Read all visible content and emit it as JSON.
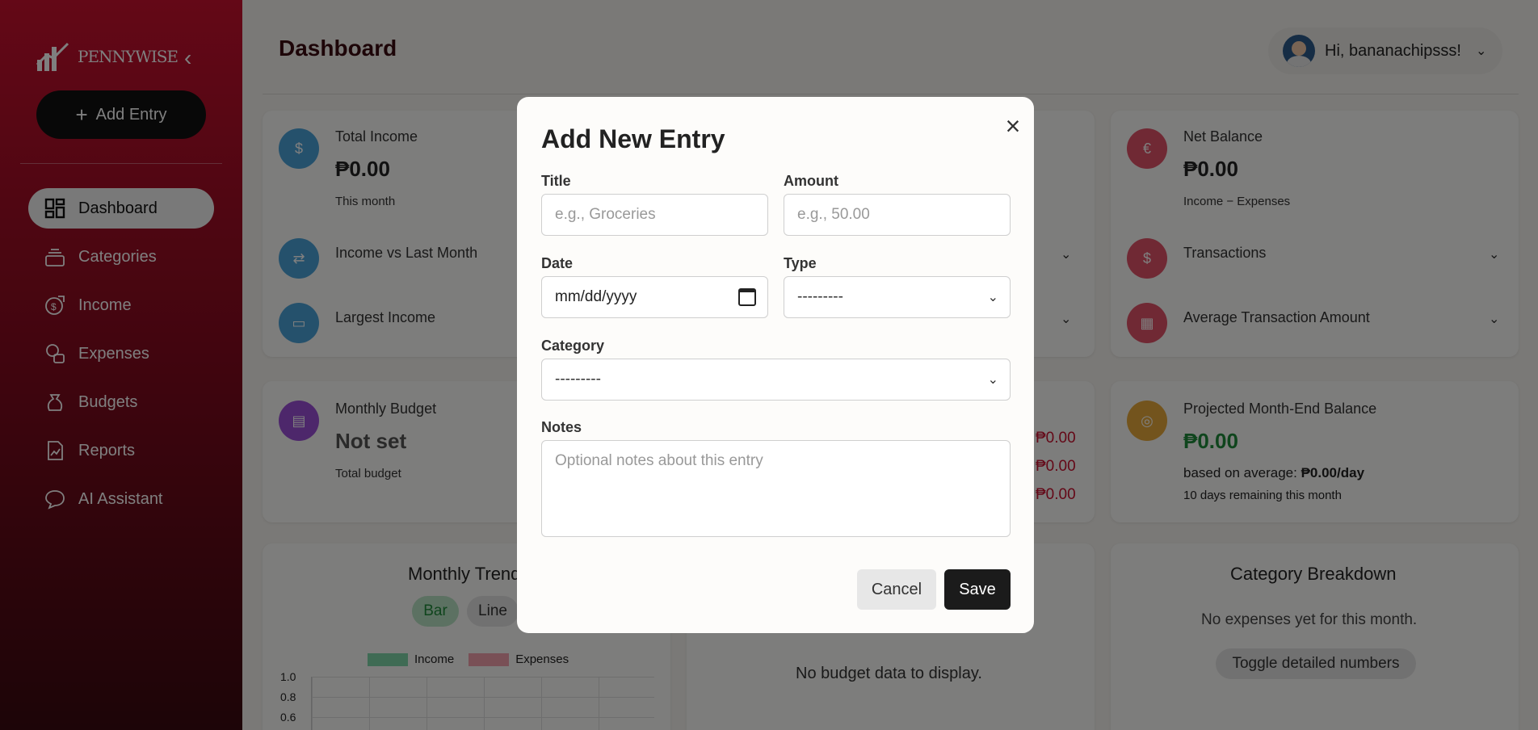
{
  "app": {
    "logo_text": "PENNYWISE"
  },
  "sidebar": {
    "add_entry_label": "Add Entry",
    "items": [
      {
        "label": "Dashboard",
        "icon": "dashboard-icon",
        "active": true
      },
      {
        "label": "Categories",
        "icon": "categories-icon"
      },
      {
        "label": "Income",
        "icon": "income-icon"
      },
      {
        "label": "Expenses",
        "icon": "expenses-icon"
      },
      {
        "label": "Budgets",
        "icon": "budgets-icon"
      },
      {
        "label": "Reports",
        "icon": "reports-icon"
      },
      {
        "label": "AI Assistant",
        "icon": "chat-icon"
      }
    ]
  },
  "header": {
    "title": "Dashboard",
    "greeting": "Hi, bananachipsss!"
  },
  "cards": {
    "total_income": {
      "label": "Total Income",
      "value": "₱0.00",
      "sub": "This month"
    },
    "income_vs_last": {
      "label": "Income vs Last Month"
    },
    "largest_income": {
      "label": "Largest Income"
    },
    "net_balance": {
      "label": "Net Balance",
      "value": "₱0.00",
      "sub": "Income − Expenses"
    },
    "transactions": {
      "label": "Transactions"
    },
    "avg_transaction": {
      "label": "Average Transaction Amount"
    },
    "monthly_budget": {
      "label": "Monthly Budget",
      "value": "Not set",
      "sub": "Total budget"
    },
    "mid_values": [
      "₱0.00",
      "₱0.00",
      "₱0.00"
    ],
    "projected": {
      "label": "Projected Month-End Balance",
      "value": "₱0.00",
      "based_label": "based on average:",
      "based_value": "₱0.00/day",
      "remaining": "10 days remaining this month"
    },
    "monthly_trend": {
      "title": "Monthly Trend",
      "toggle_bar": "Bar",
      "toggle_line": "Line",
      "legend_income": "Income",
      "legend_expenses": "Expenses",
      "yticks": [
        "1.0",
        "0.8",
        "0.6"
      ]
    },
    "budget_empty": "No budget data to display.",
    "category_breakdown": {
      "title": "Category Breakdown",
      "empty": "No expenses yet for this month.",
      "toggle": "Toggle detailed numbers"
    }
  },
  "modal": {
    "title": "Add New Entry",
    "title_label": "Title",
    "title_placeholder": "e.g., Groceries",
    "amount_label": "Amount",
    "amount_placeholder": "e.g., 50.00",
    "date_label": "Date",
    "date_placeholder": "mm/dd/yyyy",
    "type_label": "Type",
    "type_value": "---------",
    "category_label": "Category",
    "category_value": "---------",
    "notes_label": "Notes",
    "notes_placeholder": "Optional notes about this entry",
    "cancel_label": "Cancel",
    "save_label": "Save"
  },
  "colors": {
    "accent": "#c8102e",
    "sidebar_dark": "#3a0a10",
    "income_series": "#1f9d5b",
    "expenses_series": "#e05268"
  }
}
